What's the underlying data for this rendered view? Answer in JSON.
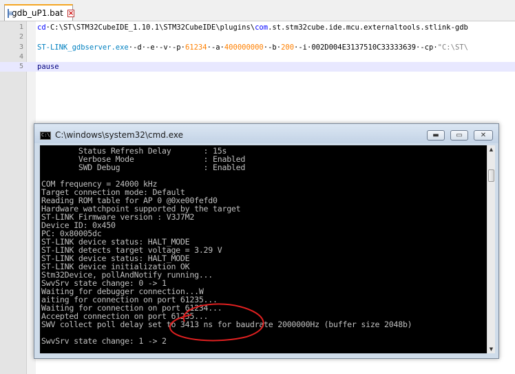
{
  "editor": {
    "tab_label": "gdb_uP1.bat",
    "lines": [
      {
        "num": "1",
        "segments": [
          {
            "t": "cd",
            "c": "kw-blue"
          },
          {
            "t": "·C:\\ST\\STM32CubeIDE_1.10.1\\STM32CubeIDE\\plugins\\",
            "c": ""
          },
          {
            "t": "com",
            "c": "kw-blue"
          },
          {
            "t": ".st.stm32cube.ide.mcu.externaltools.stlink-gdb",
            "c": ""
          }
        ]
      },
      {
        "num": "2",
        "segments": []
      },
      {
        "num": "3",
        "segments": [
          {
            "t": "ST-LINK_gdbserver.exe",
            "c": "kw-teal"
          },
          {
            "t": "·-d·-e·-v·-p·",
            "c": ""
          },
          {
            "t": "61234",
            "c": "kw-num"
          },
          {
            "t": "·-a·",
            "c": ""
          },
          {
            "t": "400000000",
            "c": "kw-num"
          },
          {
            "t": "·-b·",
            "c": ""
          },
          {
            "t": "200",
            "c": "kw-num"
          },
          {
            "t": "·-i·002D004E3137510C33333639·-cp·",
            "c": ""
          },
          {
            "t": "\"C:\\ST\\",
            "c": "kw-str"
          }
        ]
      },
      {
        "num": "4",
        "segments": []
      },
      {
        "num": "5",
        "segments": [
          {
            "t": "pause",
            "c": "kw-darkblue"
          }
        ]
      }
    ]
  },
  "cmd": {
    "title": "C:\\windows\\system32\\cmd.exe",
    "min_symbol": "▬",
    "max_symbol": "▭",
    "close_symbol": "✕",
    "scroll_up": "▲",
    "scroll_down": "▼",
    "lines": [
      "        Status Refresh Delay       : 15s",
      "        Verbose Mode               : Enabled",
      "        SWD Debug                  : Enabled",
      "",
      "COM frequency = 24000 kHz",
      "Target connection mode: Default",
      "Reading ROM table for AP 0 @0xe00fefd0",
      "Hardware watchpoint supported by the target",
      "ST-LINK Firmware version : V3J7M2",
      "Device ID: 0x450",
      "PC: 0x80005dc",
      "ST-LINK device status: HALT_MODE",
      "ST-LINK detects target voltage = 3.29 V",
      "ST-LINK device status: HALT_MODE",
      "ST-LINK device initialization OK",
      "Stm32Device, pollAndNotify running...",
      "SwvSrv state change: 0 -> 1",
      "Waiting for debugger connection...W",
      "aiting for connection on port 61235...",
      "Waiting for connection on port 61234...",
      "Accepted connection on port 61235...",
      "SWV collect poll delay set to 3413 ns for baudrate 2000000Hz (buffer size 2048b)",
      "",
      "SwvSrv state change: 1 -> 2"
    ]
  },
  "colors": {
    "annotation": "#e02020",
    "console_text": "#c0c0c0",
    "console_bg": "#000000"
  }
}
